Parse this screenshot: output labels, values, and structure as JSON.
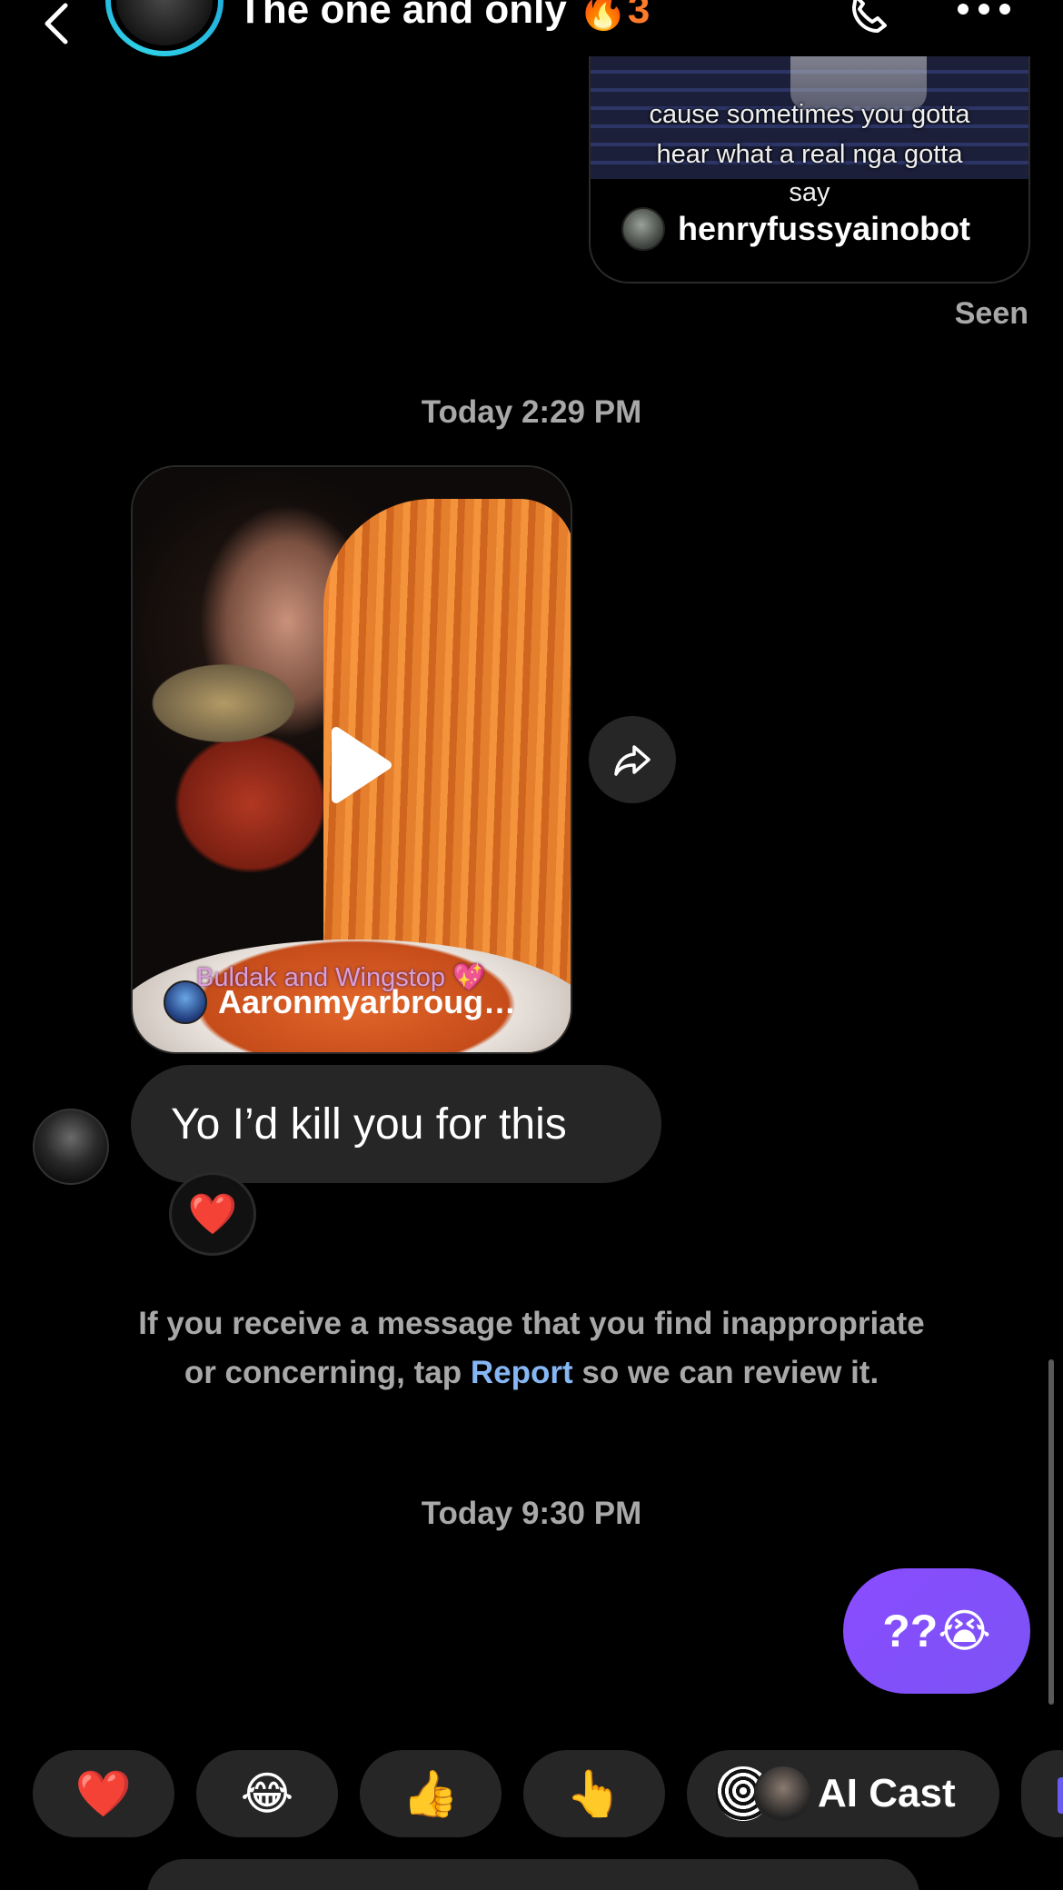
{
  "header": {
    "title": "The one and only",
    "streak_emoji": "🔥",
    "streak_count": "3"
  },
  "shared_reel_top": {
    "caption_lines": [
      "cause sometimes you gotta",
      "hear what a real nga gotta",
      "say"
    ],
    "owner": "henryfussyainobot"
  },
  "seen_label": "Seen",
  "timestamps": {
    "first": "Today 2:29 PM",
    "second": "Today 9:30 PM"
  },
  "shared_reel_received": {
    "caption": "Buldak and Wingstop 💖",
    "owner": "Aaronmyarbroug…"
  },
  "received_message": {
    "text": "Yo I’d kill you for this",
    "reaction": "❤️"
  },
  "notice": {
    "before": "If you receive a message that you find inappropriate or concerning, tap ",
    "link": "Report",
    "after": " so we can review it."
  },
  "outgoing_message": {
    "text": "??😭"
  },
  "quick_reactions": [
    "❤️",
    "😂",
    "👍",
    "👆"
  ],
  "ai_cast": {
    "label": "AI Cast"
  },
  "colors": {
    "bubble_incoming": "#262626",
    "bubble_outgoing": "#7b53f4",
    "link": "#86b6f4",
    "meta_text": "#a8a8a8",
    "streak": "#ff7a2a"
  }
}
